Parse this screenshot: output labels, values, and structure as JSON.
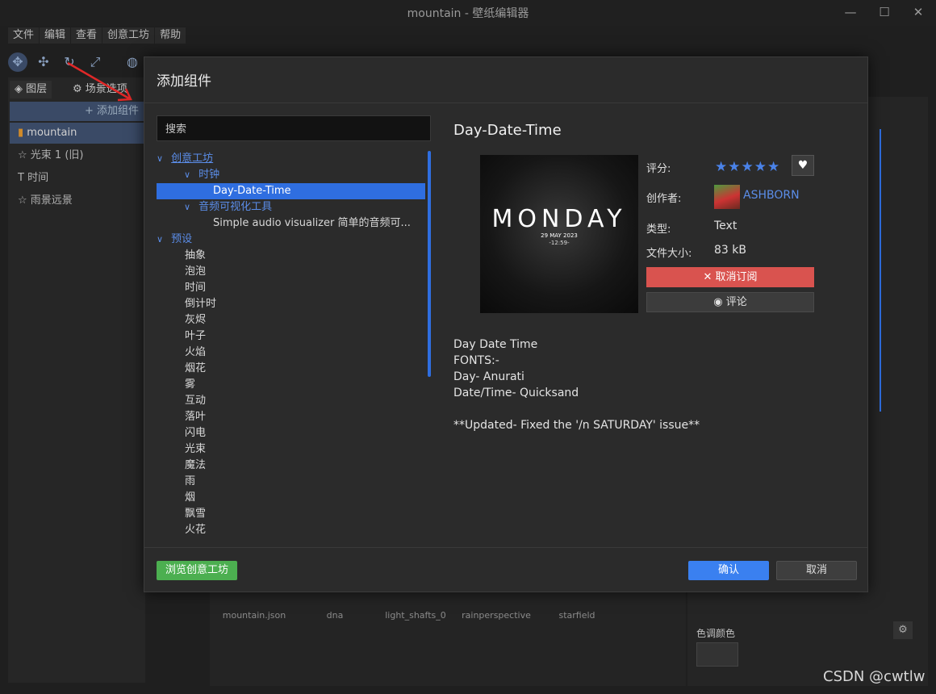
{
  "window": {
    "title": "mountain - 壁纸编辑器",
    "min": "—",
    "max": "☐",
    "close": "✕"
  },
  "menu": [
    "文件",
    "编辑",
    "查看",
    "创意工坊",
    "帮助"
  ],
  "left_panel": {
    "tabs": [
      "图层",
      "场景选项"
    ],
    "add_component": "添加组件",
    "layers": [
      "mountain",
      "光束 1 (旧)",
      "时间",
      "雨景远景"
    ]
  },
  "bottom_assets": [
    "mountain.json",
    "dna",
    "light_shafts_0",
    "rainperspective",
    "starfield"
  ],
  "right_panel": {
    "color_label": "色调颜色"
  },
  "dialog": {
    "title": "添加组件",
    "search_placeholder": "搜索",
    "tree": {
      "workshop": "创意工坊",
      "clock": "时钟",
      "clock_item": "Day-Date-Time",
      "audio": "音频可视化工具",
      "audio_item": "Simple audio visualizer 简单的音频可...",
      "presets_label": "预设",
      "presets": [
        "抽象",
        "泡泡",
        "时间",
        "倒计时",
        "灰烬",
        "叶子",
        "火焰",
        "烟花",
        "雾",
        "互动",
        "落叶",
        "闪电",
        "光束",
        "魔法",
        "雨",
        "烟",
        "飘雪",
        "火花"
      ]
    },
    "detail": {
      "name": "Day-Date-Time",
      "preview": {
        "main": "MONDAY",
        "date": "29 MAY 2023",
        "time": "-12:59-"
      },
      "rating_label": "评分:",
      "rating": 5,
      "stars": "★★★★★",
      "author_label": "创作者:",
      "author": "ASHBORN",
      "type_label": "类型:",
      "type": "Text",
      "size_label": "文件大小:",
      "size": "83 kB",
      "unsubscribe": "✕ 取消订阅",
      "comment": "评论",
      "description": [
        "Day Date Time",
        "FONTS:-",
        "Day- Anurati",
        "Date/Time- Quicksand",
        "",
        "**Updated- Fixed the '/n SATURDAY' issue**"
      ]
    },
    "browse_workshop": "浏览创意工坊",
    "ok": "确认",
    "cancel": "取消"
  },
  "watermark": "CSDN @cwtlw",
  "colors": {
    "accent": "#2f6ee0",
    "link": "#5b8de8",
    "danger": "#d9534f",
    "success": "#4caf50"
  }
}
